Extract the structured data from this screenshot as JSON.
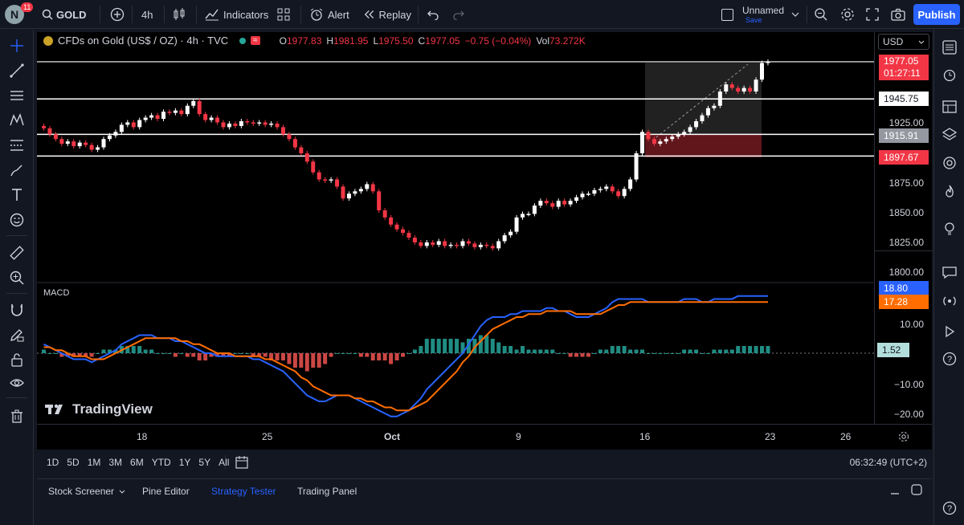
{
  "topbar": {
    "avatar_letter": "N",
    "notification_count": "11",
    "symbol": "GOLD",
    "interval": "4h",
    "indicators_label": "Indicators",
    "alert_label": "Alert",
    "replay_label": "Replay",
    "layout_name": "Unnamed",
    "layout_status": "Save",
    "publish_label": "Publish"
  },
  "legend": {
    "instrument": "CFDs on Gold (US$ / OZ) · 4h · TVC",
    "o_label": "O",
    "o_val": "1977.83",
    "h_label": "H",
    "h_val": "1981.95",
    "l_label": "L",
    "l_val": "1975.50",
    "c_label": "C",
    "c_val": "1977.05",
    "change": "−0.75 (−0.04%)",
    "vol_label": "Vol",
    "vol_val": "73.272K",
    "indicator_name": "MACD",
    "watermark": "TradingView"
  },
  "price_scale": {
    "currency": "USD",
    "ticks": [
      "1925.00",
      "1875.00",
      "1850.00",
      "1825.00",
      "1800.00"
    ],
    "last_price": "1977.05",
    "countdown": "01:27:11",
    "line_1945": "1945.75",
    "line_1915": "1915.91",
    "line_1897": "1897.67"
  },
  "macd_scale": {
    "macd_val": "18.80",
    "signal_val": "17.28",
    "hist_val": "1.52",
    "ticks": [
      "10.00",
      "−10.00",
      "−20.00"
    ]
  },
  "time_scale": [
    "18",
    "25",
    "Oct",
    "9",
    "16",
    "23",
    "26"
  ],
  "ranges": [
    "1D",
    "5D",
    "1M",
    "3M",
    "6M",
    "YTD",
    "1Y",
    "5Y",
    "All"
  ],
  "clock": "06:32:49 (UTC+2)",
  "panel_tabs": {
    "screener": "Stock Screener",
    "pine": "Pine Editor",
    "strategy": "Strategy Tester",
    "trading": "Trading Panel"
  },
  "colors": {
    "up": "#ffffff",
    "down": "#f23645",
    "macd": "#2962ff",
    "signal": "#ff6d00",
    "accent": "#2962ff",
    "hist_up": "#26a69a",
    "hist_down": "#ef5350"
  },
  "chart_data": {
    "type": "candlestick",
    "closes": [
      1921,
      1916,
      1912,
      1908,
      1910,
      1906,
      1909,
      1907,
      1903,
      1905,
      1912,
      1915,
      1918,
      1924,
      1926,
      1922,
      1928,
      1930,
      1932,
      1929,
      1935,
      1934,
      1936,
      1933,
      1940,
      1944,
      1933,
      1928,
      1930,
      1926,
      1922,
      1925,
      1923,
      1927,
      1926,
      1925,
      1926,
      1924,
      1925,
      1922,
      1916,
      1912,
      1905,
      1900,
      1893,
      1884,
      1878,
      1877,
      1878,
      1872,
      1862,
      1866,
      1868,
      1870,
      1874,
      1868,
      1852,
      1846,
      1840,
      1836,
      1833,
      1829,
      1825,
      1822,
      1825,
      1823,
      1826,
      1822,
      1823,
      1822,
      1826,
      1824,
      1821,
      1823,
      1822,
      1820,
      1826,
      1831,
      1834,
      1846,
      1849,
      1849,
      1856,
      1860,
      1858,
      1855,
      1860,
      1857,
      1860,
      1863,
      1866,
      1866,
      1869,
      1870,
      1872,
      1868,
      1864,
      1870,
      1878,
      1900,
      1918,
      1912,
      1908,
      1910,
      1912,
      1914,
      1916,
      1918,
      1922,
      1927,
      1932,
      1938,
      1940,
      1952,
      1958,
      1955,
      1952,
      1955,
      1952,
      1962,
      1976,
      1977
    ],
    "macd": [
      3,
      2,
      1,
      0,
      -1,
      -2,
      -2,
      -2,
      -3,
      -2,
      -1,
      0,
      1,
      3,
      4,
      5,
      6,
      6,
      6,
      5,
      5,
      5,
      4,
      4,
      3,
      2,
      1,
      0,
      0,
      -1,
      -1,
      -1,
      -1,
      -1,
      -1,
      -2,
      -2,
      -3,
      -4,
      -5,
      -6,
      -8,
      -10,
      -12,
      -14,
      -15,
      -16,
      -16,
      -15,
      -14,
      -14,
      -14,
      -15,
      -16,
      -17,
      -18,
      -19,
      -20,
      -21,
      -21,
      -20,
      -19,
      -17,
      -15,
      -12,
      -10,
      -8,
      -6,
      -4,
      -2,
      0,
      3,
      6,
      9,
      11,
      12,
      12,
      12,
      13,
      13,
      14,
      14,
      14,
      14,
      15,
      15,
      14,
      14,
      13,
      12,
      12,
      12,
      13,
      14,
      15,
      17,
      18,
      18,
      18,
      18,
      18,
      17,
      17,
      17,
      17,
      17,
      17,
      18,
      18,
      18,
      17,
      17,
      18,
      18,
      18,
      18,
      19,
      19,
      19,
      19,
      19,
      19
    ],
    "signal": [
      2,
      2,
      1,
      1,
      0,
      -1,
      -1,
      -1,
      -2,
      -2,
      -2,
      -1,
      0,
      1,
      2,
      3,
      4,
      5,
      5,
      5,
      5,
      5,
      5,
      4,
      4,
      3,
      3,
      2,
      1,
      0,
      0,
      0,
      -1,
      -1,
      -1,
      -1,
      -1,
      -2,
      -2,
      -3,
      -4,
      -5,
      -6,
      -8,
      -9,
      -11,
      -12,
      -13,
      -14,
      -14,
      -14,
      -14,
      -15,
      -15,
      -16,
      -16,
      -17,
      -18,
      -18,
      -19,
      -19,
      -19,
      -18,
      -17,
      -16,
      -14,
      -12,
      -10,
      -8,
      -6,
      -3,
      -1,
      2,
      4,
      6,
      8,
      9,
      10,
      11,
      12,
      12,
      13,
      13,
      13,
      14,
      14,
      14,
      14,
      14,
      13,
      13,
      13,
      13,
      13,
      14,
      15,
      16,
      16,
      17,
      17,
      17,
      17,
      17,
      17,
      17,
      17,
      17,
      17,
      17,
      17,
      17,
      17,
      17,
      17,
      17,
      17,
      17,
      17,
      17,
      17,
      17,
      17
    ]
  }
}
